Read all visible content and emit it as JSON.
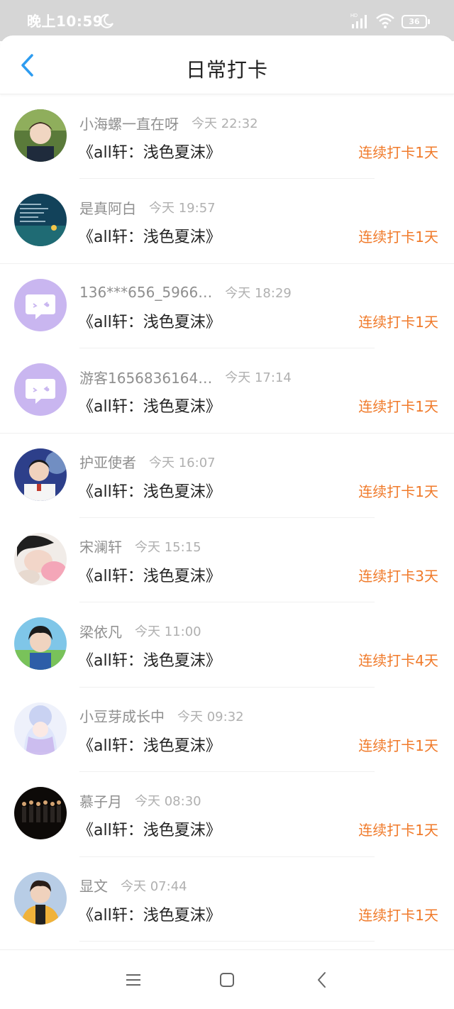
{
  "status_bar": {
    "time": "晚上10:59",
    "battery": "36",
    "icons": [
      "moon-icon",
      "signal-icon",
      "wifi-icon",
      "battery-icon"
    ]
  },
  "header": {
    "title": "日常打卡",
    "back_icon": "chevron-left-icon",
    "accent_color": "#2d9cf0"
  },
  "colors": {
    "streak": "#f07a2a",
    "username": "#8f8f8f",
    "timestamp": "#b0b0b0"
  },
  "checkins": [
    {
      "username": "小海螺一直在呀",
      "time": "今天 22:32",
      "book": "《all轩：浅色夏沫》",
      "streak": "连续打卡1天",
      "avatar": "photo-avatar"
    },
    {
      "username": "是真阿白",
      "time": "今天 19:57",
      "book": "《all轩：浅色夏沫》",
      "streak": "连续打卡1天",
      "avatar": "photo-avatar"
    },
    {
      "username": "136***656_5966…",
      "time": "今天 18:29",
      "book": "《all轩：浅色夏沫》",
      "streak": "连续打卡1天",
      "avatar": "default-avatar"
    },
    {
      "username": "游客1656836164…",
      "time": "今天 17:14",
      "book": "《all轩：浅色夏沫》",
      "streak": "连续打卡1天",
      "avatar": "default-avatar"
    },
    {
      "username": "护亚使者",
      "time": "今天 16:07",
      "book": "《all轩：浅色夏沫》",
      "streak": "连续打卡1天",
      "avatar": "photo-avatar"
    },
    {
      "username": "宋澜轩",
      "time": "今天 15:15",
      "book": "《all轩：浅色夏沫》",
      "streak": "连续打卡3天",
      "avatar": "photo-avatar"
    },
    {
      "username": "梁依凡",
      "time": "今天 11:00",
      "book": "《all轩：浅色夏沫》",
      "streak": "连续打卡4天",
      "avatar": "photo-avatar"
    },
    {
      "username": "小豆芽成长中",
      "time": "今天 09:32",
      "book": "《all轩：浅色夏沫》",
      "streak": "连续打卡1天",
      "avatar": "photo-avatar"
    },
    {
      "username": "慕子月",
      "time": "今天 08:30",
      "book": "《all轩：浅色夏沫》",
      "streak": "连续打卡1天",
      "avatar": "photo-avatar"
    },
    {
      "username": "显文",
      "time": "今天 07:44",
      "book": "《all轩：浅色夏沫》",
      "streak": "连续打卡1天",
      "avatar": "photo-avatar"
    }
  ],
  "nav_bar": {
    "icons": [
      "menu-icon",
      "home-square-icon",
      "back-triangle-icon"
    ]
  }
}
